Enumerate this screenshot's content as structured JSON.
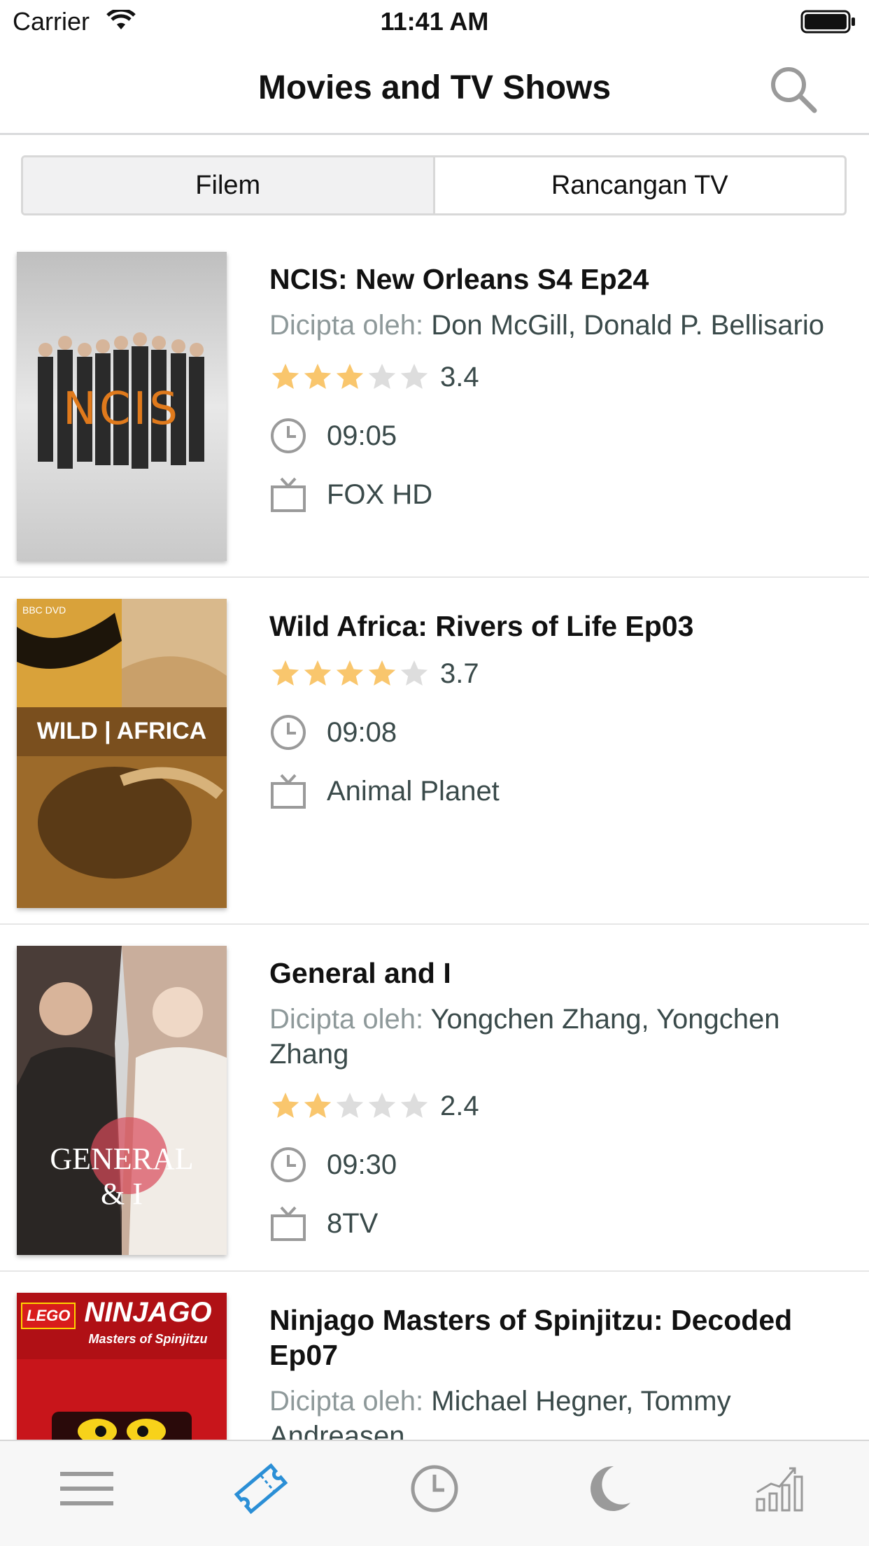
{
  "status_bar": {
    "carrier": "Carrier",
    "time": "11:41 AM"
  },
  "header": {
    "title": "Movies and TV Shows"
  },
  "segments": [
    {
      "label": "Filem",
      "selected": true
    },
    {
      "label": "Rancangan TV",
      "selected": false
    }
  ],
  "items": [
    {
      "title": "NCIS: New Orleans S4 Ep24",
      "created_by_label": "Dicipta oleh:",
      "creators": "Don McGill, Donald P. Bellisario",
      "rating": "3.4",
      "time": "09:05",
      "channel": "FOX HD",
      "poster_text": "NCIS"
    },
    {
      "title": "Wild Africa: Rivers of Life Ep03",
      "rating": "3.7",
      "time": "09:08",
      "channel": "Animal Planet",
      "poster_text": "WILD | AFRICA",
      "poster_badge": "BBC DVD"
    },
    {
      "title": "General and I",
      "created_by_label": "Dicipta oleh:",
      "creators": "Yongchen Zhang, Yongchen Zhang",
      "rating": "2.4",
      "time": "09:30",
      "channel": "8TV",
      "poster_text": "GENERAL & I"
    },
    {
      "title": "Ninjago Masters of Spinjitzu: Decoded Ep07",
      "created_by_label": "Dicipta oleh:",
      "creators": "Michael Hegner, Tommy Andreasen",
      "poster_text": "NINJAGO",
      "poster_subtext": "Masters of Spinjitzu",
      "poster_badge": "LEGO"
    }
  ],
  "tab_bar": {
    "tabs": [
      {
        "icon": "menu-icon",
        "active": false
      },
      {
        "icon": "ticket-icon",
        "active": true
      },
      {
        "icon": "clock-icon",
        "active": false
      },
      {
        "icon": "moon-icon",
        "active": false
      },
      {
        "icon": "trending-chart-icon",
        "active": false
      }
    ]
  },
  "colors": {
    "star_filled": "#f9c66d",
    "star_empty": "#dddddd",
    "accent": "#2b8fd6",
    "secondary_text": "#8e999a",
    "icon_gray": "#9a9a9a"
  }
}
